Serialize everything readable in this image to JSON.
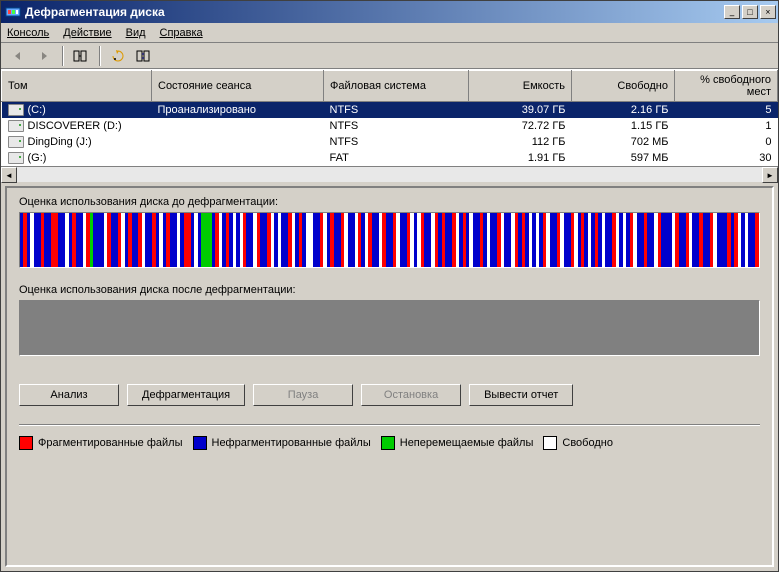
{
  "title": "Дефрагментация диска",
  "menu": {
    "console": "Консоль",
    "action": "Действие",
    "view": "Вид",
    "help": "Справка"
  },
  "columns": {
    "volume": "Том",
    "session_state": "Состояние сеанса",
    "filesystem": "Файловая система",
    "capacity": "Емкость",
    "free": "Свободно",
    "pct_free": "% свободного мест"
  },
  "volumes": [
    {
      "name": "(C:)",
      "state": "Проанализировано",
      "fs": "NTFS",
      "cap": "39.07 ГБ",
      "free": "2.16 ГБ",
      "pct": "5",
      "selected": true
    },
    {
      "name": "DISCOVERER (D:)",
      "state": "",
      "fs": "NTFS",
      "cap": "72.72 ГБ",
      "free": "1.15 ГБ",
      "pct": "1",
      "selected": false
    },
    {
      "name": "DingDing (J:)",
      "state": "",
      "fs": "NTFS",
      "cap": "112 ГБ",
      "free": "702 МБ",
      "pct": "0",
      "selected": false
    },
    {
      "name": "(G:)",
      "state": "",
      "fs": "FAT",
      "cap": "1.91 ГБ",
      "free": "597 МБ",
      "pct": "30",
      "selected": false
    }
  ],
  "labels": {
    "before": "Оценка использования диска до дефрагментации:",
    "after": "Оценка использования диска после дефрагментации:"
  },
  "buttons": {
    "analyze": "Анализ",
    "defrag": "Дефрагментация",
    "pause": "Пауза",
    "stop": "Остановка",
    "report": "Вывести отчет"
  },
  "legend": {
    "fragmented": "Фрагментированные файлы",
    "contiguous": "Нефрагментированные файлы",
    "unmovable": "Неперемещаемые файлы",
    "free": "Свободно"
  },
  "colors": {
    "fragmented": "#ff0000",
    "contiguous": "#0000cc",
    "unmovable": "#00cc00",
    "free": "#ffffff",
    "selection": "#0a246a"
  },
  "chart_data": {
    "type": "bar",
    "title": "Оценка использования диска до дефрагментации",
    "categories": [
      "Фрагментированные",
      "Нефрагментированные",
      "Неперемещаемые",
      "Свободно"
    ],
    "x": [],
    "ylim": [
      0,
      100
    ],
    "stripes": "BRBWBBRBBRRBBWBRBBWRGBBBWRBBRWBRBBRWBBRBWBRBBWBRRBWBGGGBRWBRBWBWRBBWRBBRWBWBBRWBRBWWBBRWBRBBRWBBWRBWRBBWRBBRWBBRWBWRBBWRBRBBRWBRBWBBRBWBBRWBBWRBRBWBWBRWBBRWBBRWBRBWBRBWBBRWBWBRWBBRBBWRBBBWRBBRWBBRBBRWBBBRBRWBWBBR"
  }
}
